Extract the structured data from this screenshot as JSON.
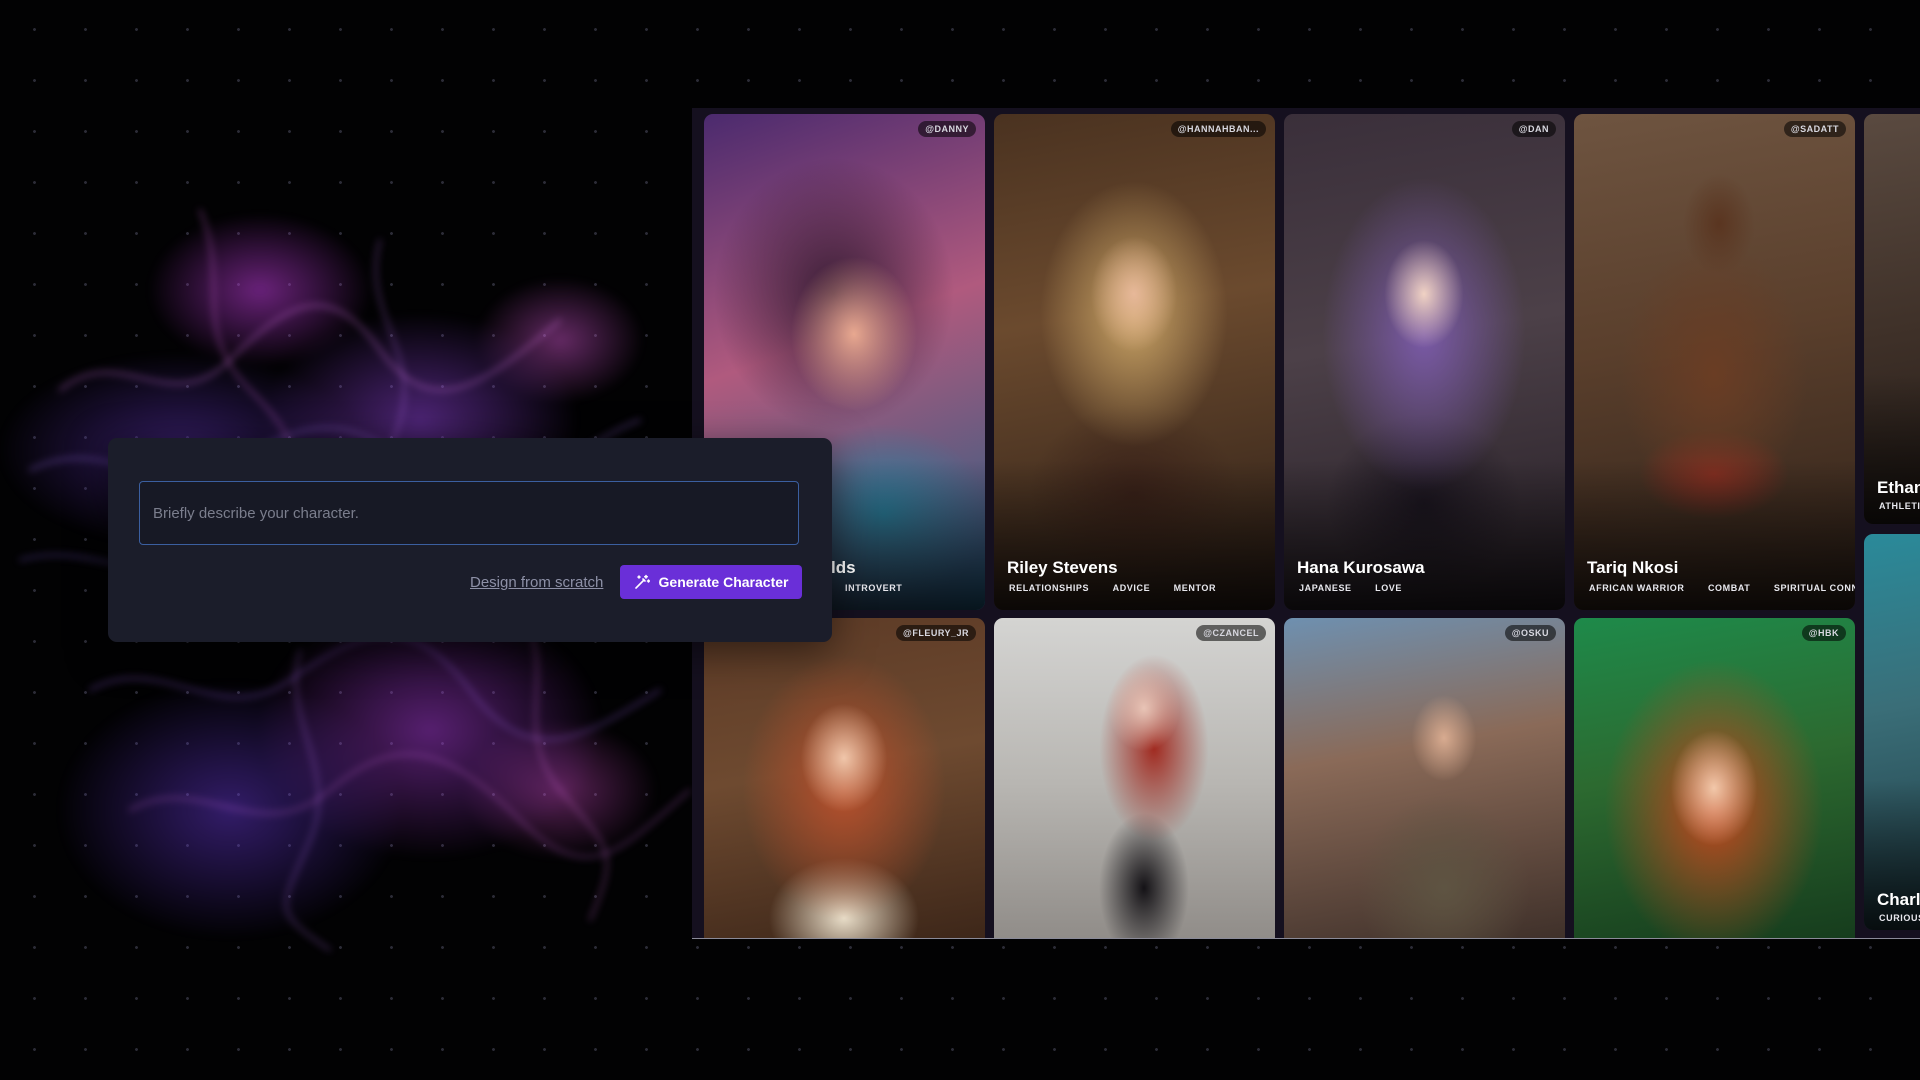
{
  "colors": {
    "background": "#020203",
    "panel": "#1b1d2a",
    "accent": "#6a2fd8",
    "input_border": "#3b5fa0"
  },
  "creator": {
    "input_placeholder": "Briefly describe your character.",
    "input_value": "",
    "design_link": "Design from scratch",
    "generate_label": "Generate Character",
    "generate_icon": "magic-wand-icon"
  },
  "gallery": {
    "top_row": [
      {
        "handle": "@DANNY",
        "name": "lds",
        "tags": [
          "INTROVERT"
        ]
      },
      {
        "handle": "@HANNAHBAN...",
        "name": "Riley Stevens",
        "tags": [
          "RELATIONSHIPS",
          "ADVICE",
          "MENTOR"
        ]
      },
      {
        "handle": "@DAN",
        "name": "Hana Kurosawa",
        "tags": [
          "JAPANESE",
          "LOVE"
        ]
      },
      {
        "handle": "@SADATT",
        "name": "Tariq Nkosi",
        "tags": [
          "AFRICAN WARRIOR",
          "COMBAT",
          "SPIRITUAL CONNECTIO"
        ]
      },
      {
        "handle": "",
        "name": "Ethan",
        "tags": [
          "ATHLETI"
        ]
      }
    ],
    "bottom_row": [
      {
        "handle": "@FLEURY_JR",
        "name": "",
        "tags": []
      },
      {
        "handle": "@CZANCEL",
        "name": "",
        "tags": []
      },
      {
        "handle": "@OSKU",
        "name": "",
        "tags": []
      },
      {
        "handle": "@HBK",
        "name": "",
        "tags": []
      },
      {
        "handle": "",
        "name": "Charl",
        "tags": [
          "CURIOUS"
        ]
      }
    ]
  }
}
